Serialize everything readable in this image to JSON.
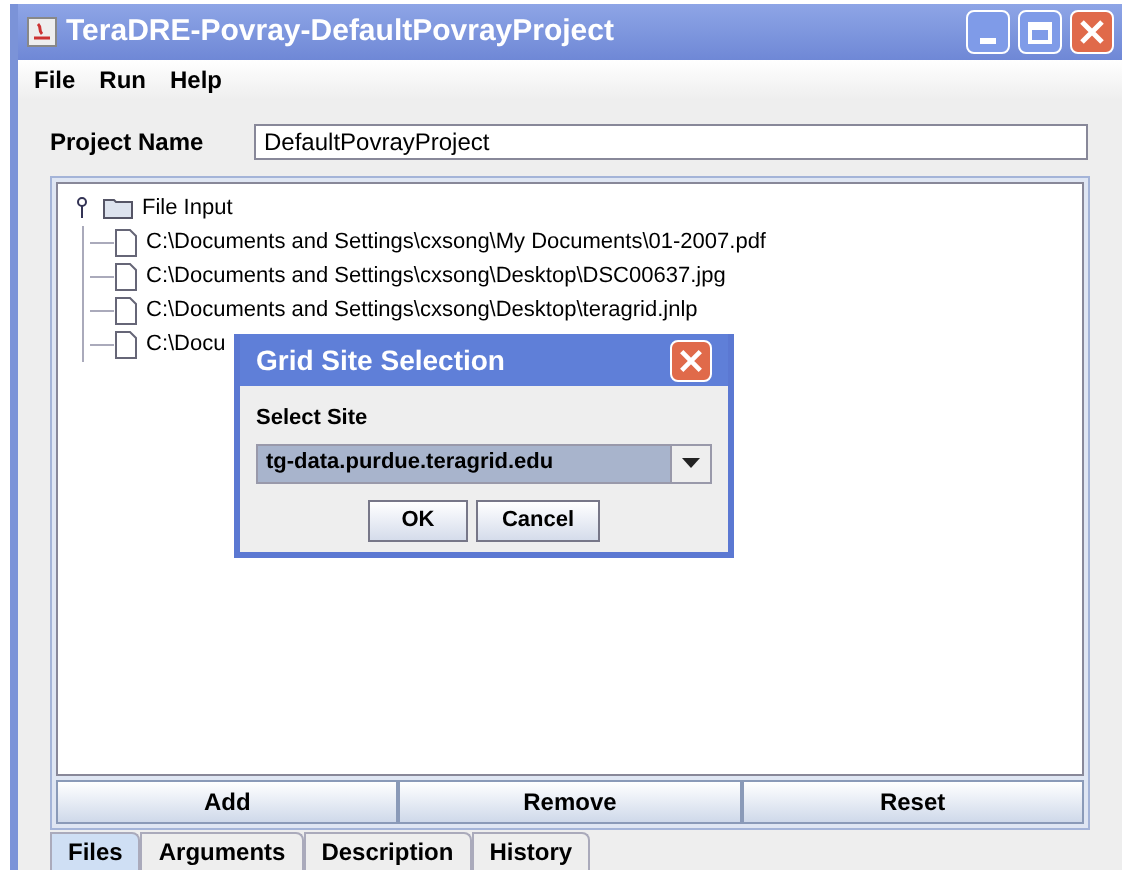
{
  "window": {
    "title": "TeraDRE-Povray-DefaultPovrayProject"
  },
  "menu": [
    "File",
    "Run",
    "Help"
  ],
  "project_name": {
    "label": "Project Name",
    "value": "DefaultPovrayProject"
  },
  "tree": {
    "label": "File Input",
    "expanded": true,
    "children": [
      {
        "label": "C:\\Documents and Settings\\cxsong\\My Documents\\01-2007.pdf"
      },
      {
        "label": "C:\\Documents and Settings\\cxsong\\Desktop\\DSC00637.jpg"
      },
      {
        "label": "C:\\Documents and Settings\\cxsong\\Desktop\\teragrid.jnlp"
      },
      {
        "label": "C:\\Docu"
      }
    ]
  },
  "buttons": [
    "Add",
    "Remove",
    "Reset"
  ],
  "tabs": [
    {
      "label": "Files",
      "selected": true
    },
    {
      "label": "Arguments",
      "selected": false
    },
    {
      "label": "Description",
      "selected": false
    },
    {
      "label": "History",
      "selected": false
    }
  ],
  "dialog": {
    "title": "Grid Site Selection",
    "label": "Select Site",
    "value": "tg-data.purdue.teragrid.edu",
    "buttons": [
      "OK",
      "Cancel"
    ]
  }
}
